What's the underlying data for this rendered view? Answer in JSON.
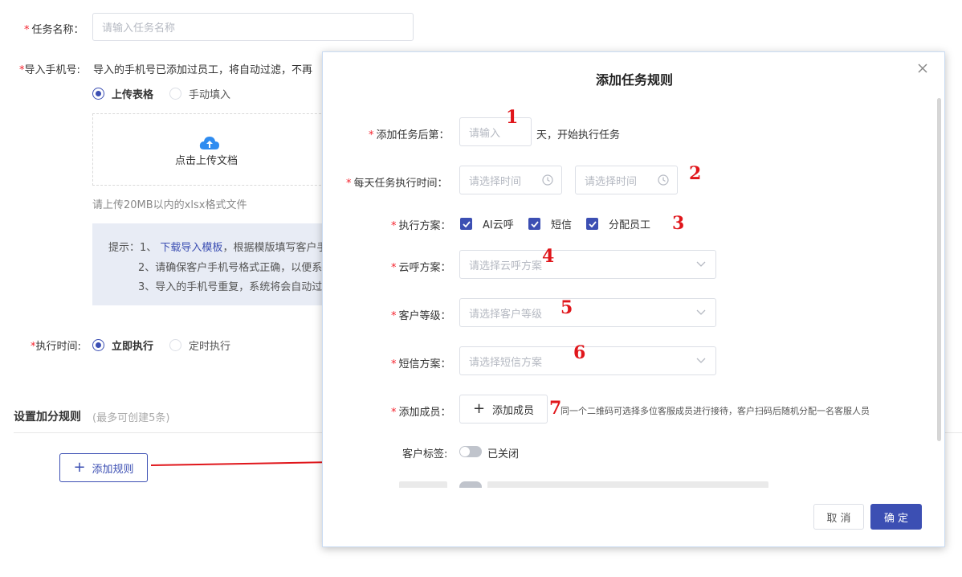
{
  "form": {
    "task_name_label": "任务名称：",
    "task_name_placeholder": "请输入任务名称",
    "import_phone_label": "导入手机号:",
    "import_phone_hint": "导入的手机号已添加过员工，将自动过滤，不再",
    "upload_table_label": "上传表格",
    "manual_fill_label": "手动填入",
    "upload_doc_label": "点击上传文档",
    "upload_note": "请上传20MB以内的xlsx格式文件",
    "tips_prefix": "提示：1、",
    "tips_link": "下载导入模板",
    "tips_line1_rest": "，根据模版填写客户手",
    "tips_line2": "2、请确保客户手机号格式正确，以便系",
    "tips_line3": "3、导入的手机号重复，系统将会自动过",
    "exec_time_label": "执行时间:",
    "exec_now_label": "立即执行",
    "exec_timed_label": "定时执行",
    "bonus_rules_title": "设置加分规则",
    "bonus_rules_hint": "(最多可创建5条)",
    "add_rule_button": "添加规则"
  },
  "dialog": {
    "title": "添加任务规则",
    "days_after_label": "添加任务后第：",
    "days_placeholder": "请输入",
    "days_suffix": "天，开始执行任务",
    "daily_time_label": "每天任务执行时间：",
    "time_placeholder_1": "请选择时间",
    "time_placeholder_2": "请选择时间",
    "exec_plan_label": "执行方案：",
    "plan_options": [
      "AI云呼",
      "短信",
      "分配员工"
    ],
    "cloud_call_label": "云呼方案：",
    "cloud_call_placeholder": "请选择云呼方案",
    "customer_level_label": "客户等级：",
    "customer_level_placeholder": "请选择客户等级",
    "sms_plan_label": "短信方案：",
    "sms_plan_placeholder": "请选择短信方案",
    "add_member_label": "添加成员：",
    "add_member_button": "添加成员",
    "add_member_hint": "同一个二维码可选择多位客服成员进行接待，客户扫码后随机分配一名客服人员",
    "customer_tag_label": "客户标签:",
    "customer_tag_state": "已关闭",
    "cancel_button": "取 消",
    "confirm_button": "确 定"
  },
  "annotations": [
    "1",
    "2",
    "3",
    "4",
    "5",
    "6",
    "7"
  ],
  "colors": {
    "primary": "#3c4fb3",
    "required": "#f5222d",
    "annotation": "#e0161b",
    "upload_icon": "#2f8cf0"
  }
}
